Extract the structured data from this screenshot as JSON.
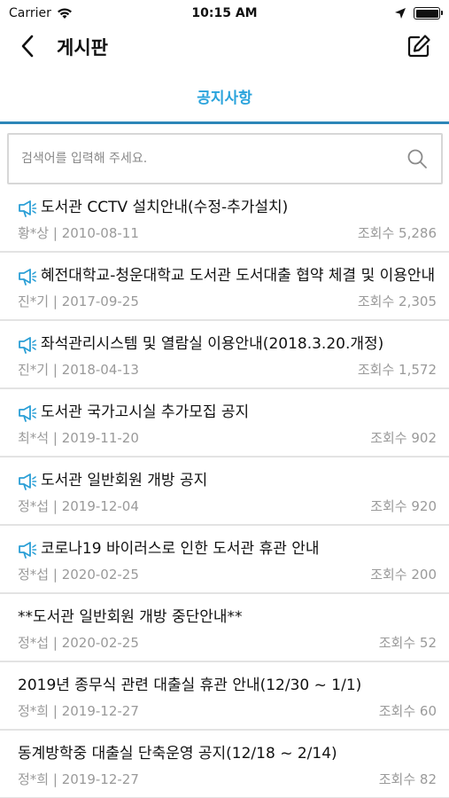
{
  "status_bar": {
    "carrier": "Carrier",
    "time": "10:15 AM"
  },
  "nav": {
    "title": "게시판",
    "back_icon": "chevron-left-icon",
    "edit_icon": "edit-icon"
  },
  "tab": {
    "label": "공지사항",
    "active_color": "#2aa3dc"
  },
  "search": {
    "placeholder": "검색어를 입력해 주세요."
  },
  "notices": [
    {
      "pinned": true,
      "title": "도서관 CCTV 설치안내(수정-추가설치)",
      "author": "황*상",
      "date": "2010-08-11",
      "views": "조회수 5,286"
    },
    {
      "pinned": true,
      "title": "혜전대학교-청운대학교 도서관 도서대출 협약 체결 및 이용안내",
      "author": "진*기",
      "date": "2017-09-25",
      "views": "조회수 2,305"
    },
    {
      "pinned": true,
      "title": "좌석관리시스템 및 열람실 이용안내(2018.3.20.개정)",
      "author": "진*기",
      "date": "2018-04-13",
      "views": "조회수 1,572"
    },
    {
      "pinned": true,
      "title": "도서관 국가고시실 추가모집 공지",
      "author": "최*석",
      "date": "2019-11-20",
      "views": "조회수 902"
    },
    {
      "pinned": true,
      "title": "도서관 일반회원 개방 공지",
      "author": "정*섭",
      "date": "2019-12-04",
      "views": "조회수 920"
    },
    {
      "pinned": true,
      "title": "코로나19 바이러스로 인한 도서관 휴관 안내",
      "author": "정*섭",
      "date": "2020-02-25",
      "views": "조회수 200"
    },
    {
      "pinned": false,
      "title": "**도서관 일반회원 개방 중단안내**",
      "author": "정*섭",
      "date": "2020-02-25",
      "views": "조회수 52"
    },
    {
      "pinned": false,
      "title": "2019년 종무식 관련 대출실 휴관 안내(12/30 ~ 1/1)",
      "author": "정*희",
      "date": "2019-12-27",
      "views": "조회수 60"
    },
    {
      "pinned": false,
      "title": "동계방학중 대출실 단축운영 공지(12/18 ~ 2/14)",
      "author": "정*희",
      "date": "2019-12-27",
      "views": "조회수 82"
    }
  ]
}
